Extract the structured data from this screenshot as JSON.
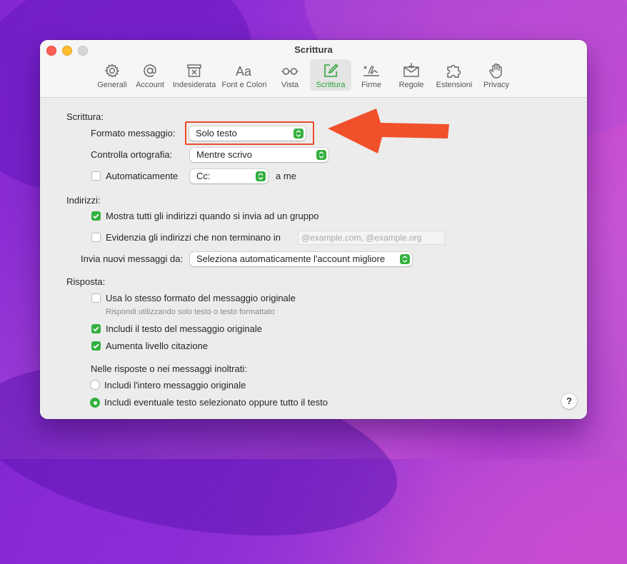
{
  "window": {
    "title": "Scrittura"
  },
  "toolbar": {
    "items": [
      {
        "label": "Generali",
        "icon": "gear-icon"
      },
      {
        "label": "Account",
        "icon": "at-icon"
      },
      {
        "label": "Indesiderata",
        "icon": "junk-box-icon"
      },
      {
        "label": "Font e Colori",
        "icon": "font-icon"
      },
      {
        "label": "Vista",
        "icon": "glasses-icon"
      },
      {
        "label": "Scrittura",
        "icon": "compose-icon",
        "active": true
      },
      {
        "label": "Firme",
        "icon": "signature-icon"
      },
      {
        "label": "Regole",
        "icon": "rules-icon"
      },
      {
        "label": "Estensioni",
        "icon": "puzzle-icon"
      },
      {
        "label": "Privacy",
        "icon": "hand-icon"
      }
    ]
  },
  "compose": {
    "section_label": "Scrittura:",
    "format_label": "Formato messaggio:",
    "format_value": "Solo testo",
    "spell_label": "Controlla ortografia:",
    "spell_value": "Mentre scrivo",
    "auto_label": "Automaticamente",
    "auto_checked": false,
    "auto_value": "Cc:",
    "auto_suffix": "a me"
  },
  "addresses": {
    "section_label": "Indirizzi:",
    "show_all_label": "Mostra tutti gli indirizzi quando si invia ad un gruppo",
    "show_all_checked": true,
    "highlight_label": "Evidenzia gli indirizzi che non terminano in",
    "highlight_checked": false,
    "domains_placeholder": "@example.com, @example.org",
    "send_from_label": "Invia nuovi messaggi da:",
    "send_from_value": "Seleziona automaticamente l'account migliore"
  },
  "reply": {
    "section_label": "Risposta:",
    "same_format_label": "Usa lo stesso formato del messaggio originale",
    "same_format_checked": false,
    "same_format_hint": "Rispondi utilizzando solo testo o testo formattato",
    "include_text_label": "Includi il testo del messaggio originale",
    "include_text_checked": true,
    "increase_quote_label": "Aumenta livello citazione",
    "increase_quote_checked": true,
    "forward_heading": "Nelle risposte o nei messaggi inoltrati:",
    "option_all_label": "Includi l'intero messaggio originale",
    "option_selected_label": "Includi eventuale testo selezionato oppure tutto il testo",
    "selected_option": "selected"
  },
  "help": {
    "label": "?"
  },
  "colors": {
    "accent": "#33b03f",
    "annotation": "#ee4b2b"
  }
}
